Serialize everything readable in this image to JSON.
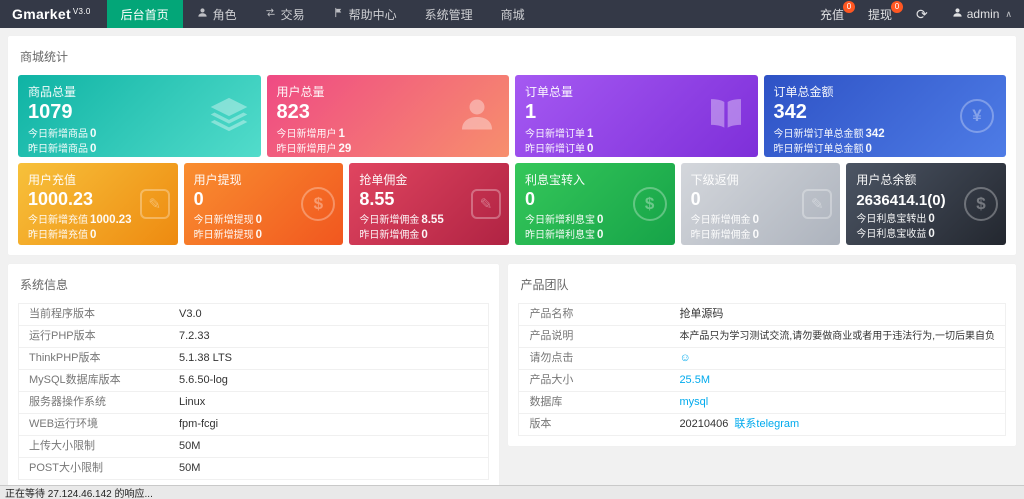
{
  "colors": {
    "navbar_bg": "#343947",
    "nav_active": "#03a678",
    "badge": "#ff5722",
    "link": "#01AAED"
  },
  "navbar": {
    "logo_main": "Gmarket",
    "logo_version": "V3.0",
    "items": [
      {
        "label": "后台首页",
        "icon": null
      },
      {
        "label": "角色",
        "icon": "user-icon"
      },
      {
        "label": "交易",
        "icon": "exchange-icon"
      },
      {
        "label": "帮助中心",
        "icon": "flag-icon"
      },
      {
        "label": "系统管理",
        "icon": null
      },
      {
        "label": "商城",
        "icon": null
      }
    ],
    "recharge": {
      "label": "充值",
      "badge": "0"
    },
    "withdraw": {
      "label": "提现",
      "badge": "0"
    },
    "refresh_icon": "refresh-icon",
    "admin": {
      "name": "admin",
      "icon": "user-icon",
      "caret": "∧"
    }
  },
  "stats": {
    "title": "商城统计",
    "row1": [
      {
        "title": "商品总量",
        "value": "1079",
        "icon": "layers-icon",
        "colors": [
          "#0fb3a4",
          "#52dccb"
        ],
        "sub1": {
          "label": "今日新增商品",
          "value": "0"
        },
        "sub2": {
          "label": "昨日新增商品",
          "value": "0"
        }
      },
      {
        "title": "用户总量",
        "value": "823",
        "icon": "user-icon",
        "colors": [
          "#ef4a84",
          "#f78f6d"
        ],
        "sub1": {
          "label": "今日新增用户",
          "value": "1"
        },
        "sub2": {
          "label": "昨日新增用户",
          "value": "29"
        }
      },
      {
        "title": "订单总量",
        "value": "1",
        "icon": "book-icon",
        "colors": [
          "#a559f2",
          "#7e2fd9"
        ],
        "sub1": {
          "label": "今日新增订单",
          "value": "1"
        },
        "sub2": {
          "label": "昨日新增订单",
          "value": "0"
        }
      },
      {
        "title": "订单总金额",
        "value": "342",
        "icon": "yen-coin-icon",
        "colors": [
          "#2e52c5",
          "#4e7ce6"
        ],
        "sub1": {
          "label": "今日新增订单总金额",
          "value": "342"
        },
        "sub2": {
          "label": "昨日新增订单总金额",
          "value": "0"
        }
      }
    ],
    "row2": [
      {
        "title": "用户充值",
        "value": "1000.23",
        "icon": "edit-note-icon",
        "colors": [
          "#f7c13b",
          "#ee8a10"
        ],
        "sub1": {
          "label": "今日新增充值",
          "value": "1000.23"
        },
        "sub2": {
          "label": "昨日新增充值",
          "value": "0"
        }
      },
      {
        "title": "用户提现",
        "value": "0",
        "icon": "dollar-coin-icon",
        "colors": [
          "#f98e30",
          "#f1571f"
        ],
        "sub1": {
          "label": "今日新增提现",
          "value": "0"
        },
        "sub2": {
          "label": "昨日新增提现",
          "value": "0"
        }
      },
      {
        "title": "抢单佣金",
        "value": "8.55",
        "icon": "edit-note-icon",
        "colors": [
          "#e04560",
          "#b02343"
        ],
        "sub1": {
          "label": "今日新增佣金",
          "value": "8.55"
        },
        "sub2": {
          "label": "昨日新增佣金",
          "value": "0"
        }
      },
      {
        "title": "利息宝转入",
        "value": "0",
        "icon": "dollar-coin-icon",
        "colors": [
          "#35c75a",
          "#16a348"
        ],
        "sub1": {
          "label": "今日新增利息宝",
          "value": "0"
        },
        "sub2": {
          "label": "昨日新增利息宝",
          "value": "0"
        }
      },
      {
        "title": "下级返佣",
        "value": "0",
        "icon": "edit-note-icon",
        "colors": [
          "#d4d7dc",
          "#adb3bd"
        ],
        "sub1": {
          "label": "今日新增佣金",
          "value": "0"
        },
        "sub2": {
          "label": "昨日新增佣金",
          "value": "0"
        }
      },
      {
        "title": "用户总余额",
        "value": "2636414.1(0)",
        "icon": "dollar-coin-icon",
        "colors": [
          "#4c5564",
          "#23272f"
        ],
        "sub1": {
          "label": "今日利息宝转出",
          "value": "0"
        },
        "sub2": {
          "label": "今日利息宝收益",
          "value": "0"
        }
      }
    ]
  },
  "system_info": {
    "title": "系统信息",
    "rows": [
      {
        "label": "当前程序版本",
        "value": "V3.0"
      },
      {
        "label": "运行PHP版本",
        "value": "7.2.33"
      },
      {
        "label": "ThinkPHP版本",
        "value": "5.1.38 LTS"
      },
      {
        "label": "MySQL数据库版本",
        "value": "5.6.50-log"
      },
      {
        "label": "服务器操作系统",
        "value": "Linux"
      },
      {
        "label": "WEB运行环境",
        "value": "fpm-fcgi"
      },
      {
        "label": "上传大小限制",
        "value": "50M"
      },
      {
        "label": "POST大小限制",
        "value": "50M"
      }
    ]
  },
  "product": {
    "title": "产品团队",
    "rows": [
      {
        "label": "产品名称",
        "value": "抢单源码"
      },
      {
        "label": "产品说明",
        "value": "本产品只为学习测试交流,请勿要做商业或者用于违法行为,一切后果自负"
      },
      {
        "label": "请勿点击",
        "value": "☺"
      },
      {
        "label": "产品大小",
        "value": "25.5M"
      },
      {
        "label": "数据库",
        "value": "mysql"
      },
      {
        "label": "版本",
        "value": "20210406",
        "link_text": "联系telegram"
      }
    ]
  },
  "statusbar": {
    "text": "正在等待 27.124.46.142 的响应..."
  }
}
